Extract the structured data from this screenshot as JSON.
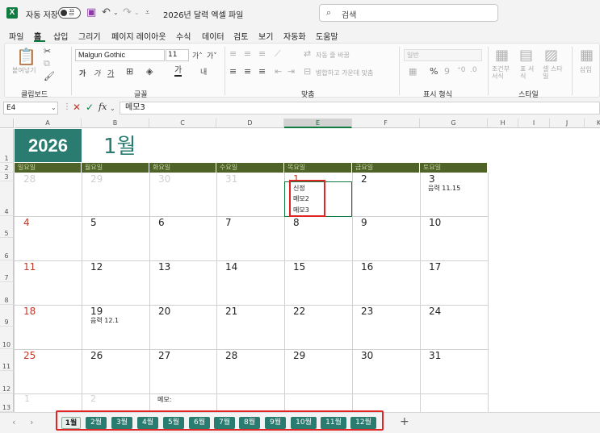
{
  "titlebar": {
    "app_icon": "excel-icon",
    "autosave_label": "자동 저장",
    "autosave_state": "끔",
    "document_title": "2026년 달력 엑셀 파일",
    "search_placeholder": "검색"
  },
  "menu": {
    "tabs": [
      "파일",
      "홈",
      "삽입",
      "그리기",
      "페이지 레이아웃",
      "수식",
      "데이터",
      "검토",
      "보기",
      "자동화",
      "도움말"
    ],
    "active": "홈"
  },
  "ribbon": {
    "clipboard": {
      "label": "클립보드",
      "paste": "붙여넣기"
    },
    "font": {
      "label": "글꼴",
      "name": "Malgun Gothic",
      "size": "11",
      "bold": "가",
      "italic": "가",
      "underline": "가"
    },
    "alignment": {
      "label": "맞춤",
      "wrap": "자동 줄 바꿈",
      "merge": "병합하고 가운데 맞춤"
    },
    "number": {
      "label": "표시 형식",
      "format": "일반",
      "percent": "%"
    },
    "styles": {
      "label": "스타일",
      "conditional": "조건부 서식",
      "as_table": "표 서식",
      "cell_styles": "셀 스타일"
    },
    "cells": {
      "insert": "삽입"
    }
  },
  "formula_bar": {
    "name_box": "E4",
    "fx": "fx",
    "content": "메모3"
  },
  "grid": {
    "columns": [
      "A",
      "B",
      "C",
      "D",
      "E",
      "F",
      "G",
      "H",
      "I",
      "J",
      "K"
    ],
    "selected_column": "E",
    "rows": [
      "1",
      "2",
      "3",
      "4",
      "5",
      "6",
      "7",
      "8",
      "9",
      "10",
      "11",
      "12",
      "13"
    ],
    "year": "2026",
    "month": "1월",
    "weekdays": [
      "일요일",
      "월요일",
      "화요일",
      "수요일",
      "목요일",
      "금요일",
      "토요일"
    ],
    "weeks": [
      [
        {
          "d": "28",
          "t": "other"
        },
        {
          "d": "29",
          "t": "other"
        },
        {
          "d": "30",
          "t": "other"
        },
        {
          "d": "31",
          "t": "other"
        },
        {
          "d": "1",
          "t": "sun"
        },
        {
          "d": "2",
          "t": "normal"
        },
        {
          "d": "3",
          "t": "normal"
        }
      ],
      [
        {
          "d": "4",
          "t": "sun"
        },
        {
          "d": "5",
          "t": "normal"
        },
        {
          "d": "6",
          "t": "normal"
        },
        {
          "d": "7",
          "t": "normal"
        },
        {
          "d": "8",
          "t": "normal"
        },
        {
          "d": "9",
          "t": "normal"
        },
        {
          "d": "10",
          "t": "normal"
        }
      ],
      [
        {
          "d": "11",
          "t": "sun"
        },
        {
          "d": "12",
          "t": "normal"
        },
        {
          "d": "13",
          "t": "normal"
        },
        {
          "d": "14",
          "t": "normal"
        },
        {
          "d": "15",
          "t": "normal"
        },
        {
          "d": "16",
          "t": "normal"
        },
        {
          "d": "17",
          "t": "normal"
        }
      ],
      [
        {
          "d": "18",
          "t": "sun"
        },
        {
          "d": "19",
          "t": "normal"
        },
        {
          "d": "20",
          "t": "normal"
        },
        {
          "d": "21",
          "t": "normal"
        },
        {
          "d": "22",
          "t": "normal"
        },
        {
          "d": "23",
          "t": "normal"
        },
        {
          "d": "24",
          "t": "normal"
        }
      ],
      [
        {
          "d": "25",
          "t": "sun"
        },
        {
          "d": "26",
          "t": "normal"
        },
        {
          "d": "27",
          "t": "normal"
        },
        {
          "d": "28",
          "t": "normal"
        },
        {
          "d": "29",
          "t": "normal"
        },
        {
          "d": "30",
          "t": "normal"
        },
        {
          "d": "31",
          "t": "normal"
        }
      ]
    ],
    "trailing": [
      "1",
      "2"
    ],
    "memo_label": "메모:",
    "notes": {
      "jan1": [
        "신정",
        "메모2",
        "메모3"
      ],
      "jan3": "음력 11.15",
      "jan19": "음력 12.1"
    }
  },
  "sheets": {
    "tabs": [
      "1월",
      "2월",
      "3월",
      "4월",
      "5월",
      "6월",
      "7월",
      "8월",
      "9월",
      "10월",
      "11월",
      "12월"
    ],
    "active": "1월",
    "add": "+"
  },
  "colors": {
    "accent": "#107c41",
    "header_teal": "#2a7c70",
    "weekday_bar": "#4f6228",
    "highlight_red": "#e02525"
  }
}
